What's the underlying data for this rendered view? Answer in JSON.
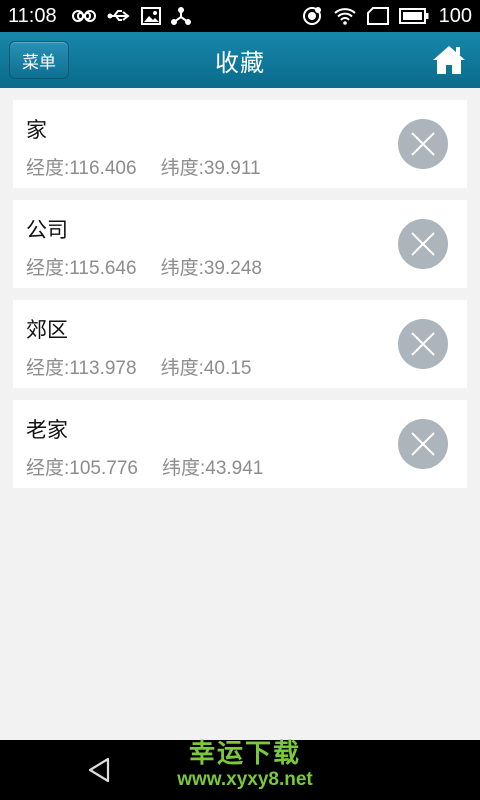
{
  "status_bar": {
    "time": "11:08",
    "battery": "100"
  },
  "header": {
    "menu_label": "菜单",
    "title": "收藏"
  },
  "favorites": [
    {
      "name": "家",
      "lng_label": "经度:116.406",
      "lat_label": "纬度:39.911"
    },
    {
      "name": "公司",
      "lng_label": "经度:115.646",
      "lat_label": "纬度:39.248"
    },
    {
      "name": "郊区",
      "lng_label": "经度:113.978",
      "lat_label": "纬度:40.15"
    },
    {
      "name": "老家",
      "lng_label": "经度:105.776",
      "lat_label": "纬度:43.941"
    }
  ],
  "watermark": {
    "title": "幸运下载",
    "url": "www.xyxy8.net"
  },
  "colors": {
    "header": "#0f7ba0",
    "delete_button": "#acb5bb",
    "watermark": "#79c93b"
  },
  "icons": {
    "home": "home-icon",
    "delete": "close-icon",
    "back": "back-triangle-icon"
  }
}
